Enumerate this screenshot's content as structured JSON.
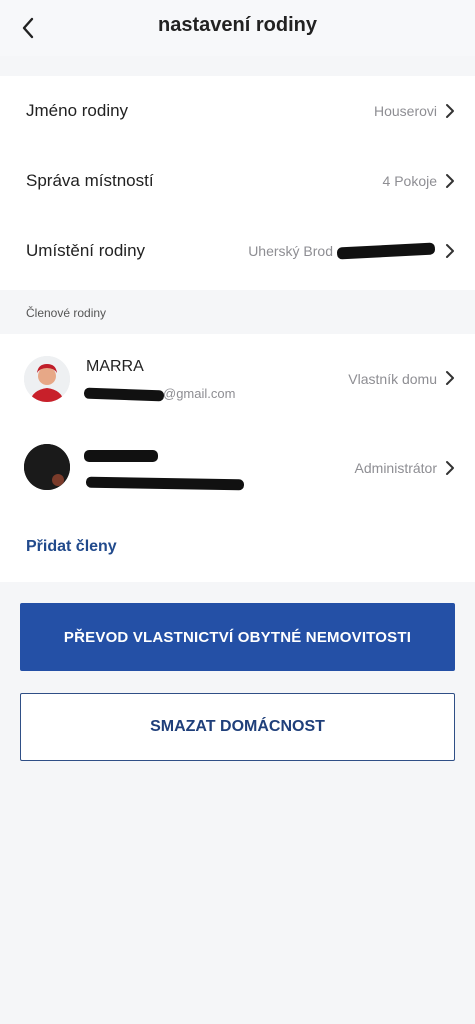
{
  "header": {
    "title": "nastavení rodiny",
    "back_icon": "chevron-left-icon"
  },
  "settings": [
    {
      "label": "Jméno rodiny",
      "value": "Houserovi"
    },
    {
      "label": "Správa místností",
      "value": "4 Pokoje"
    },
    {
      "label": "Umístění rodiny",
      "value": "Uherský Brod"
    }
  ],
  "members_section": {
    "title": "Členové rodiny"
  },
  "members": [
    {
      "name": "MARRA",
      "email_suffix": "@gmail.com",
      "role": "Vlastník domu"
    },
    {
      "name": "",
      "email_suffix": "",
      "role": "Administrátor"
    }
  ],
  "add_members_label": "Přidat členy",
  "buttons": {
    "transfer": "PŘEVOD VLASTNICTVÍ OBYTNÉ NEMOVITOSTI",
    "delete": "SMAZAT DOMÁCNOST"
  },
  "colors": {
    "accent": "#2450a6",
    "link": "#214a8c",
    "background": "#f5f6f8"
  }
}
